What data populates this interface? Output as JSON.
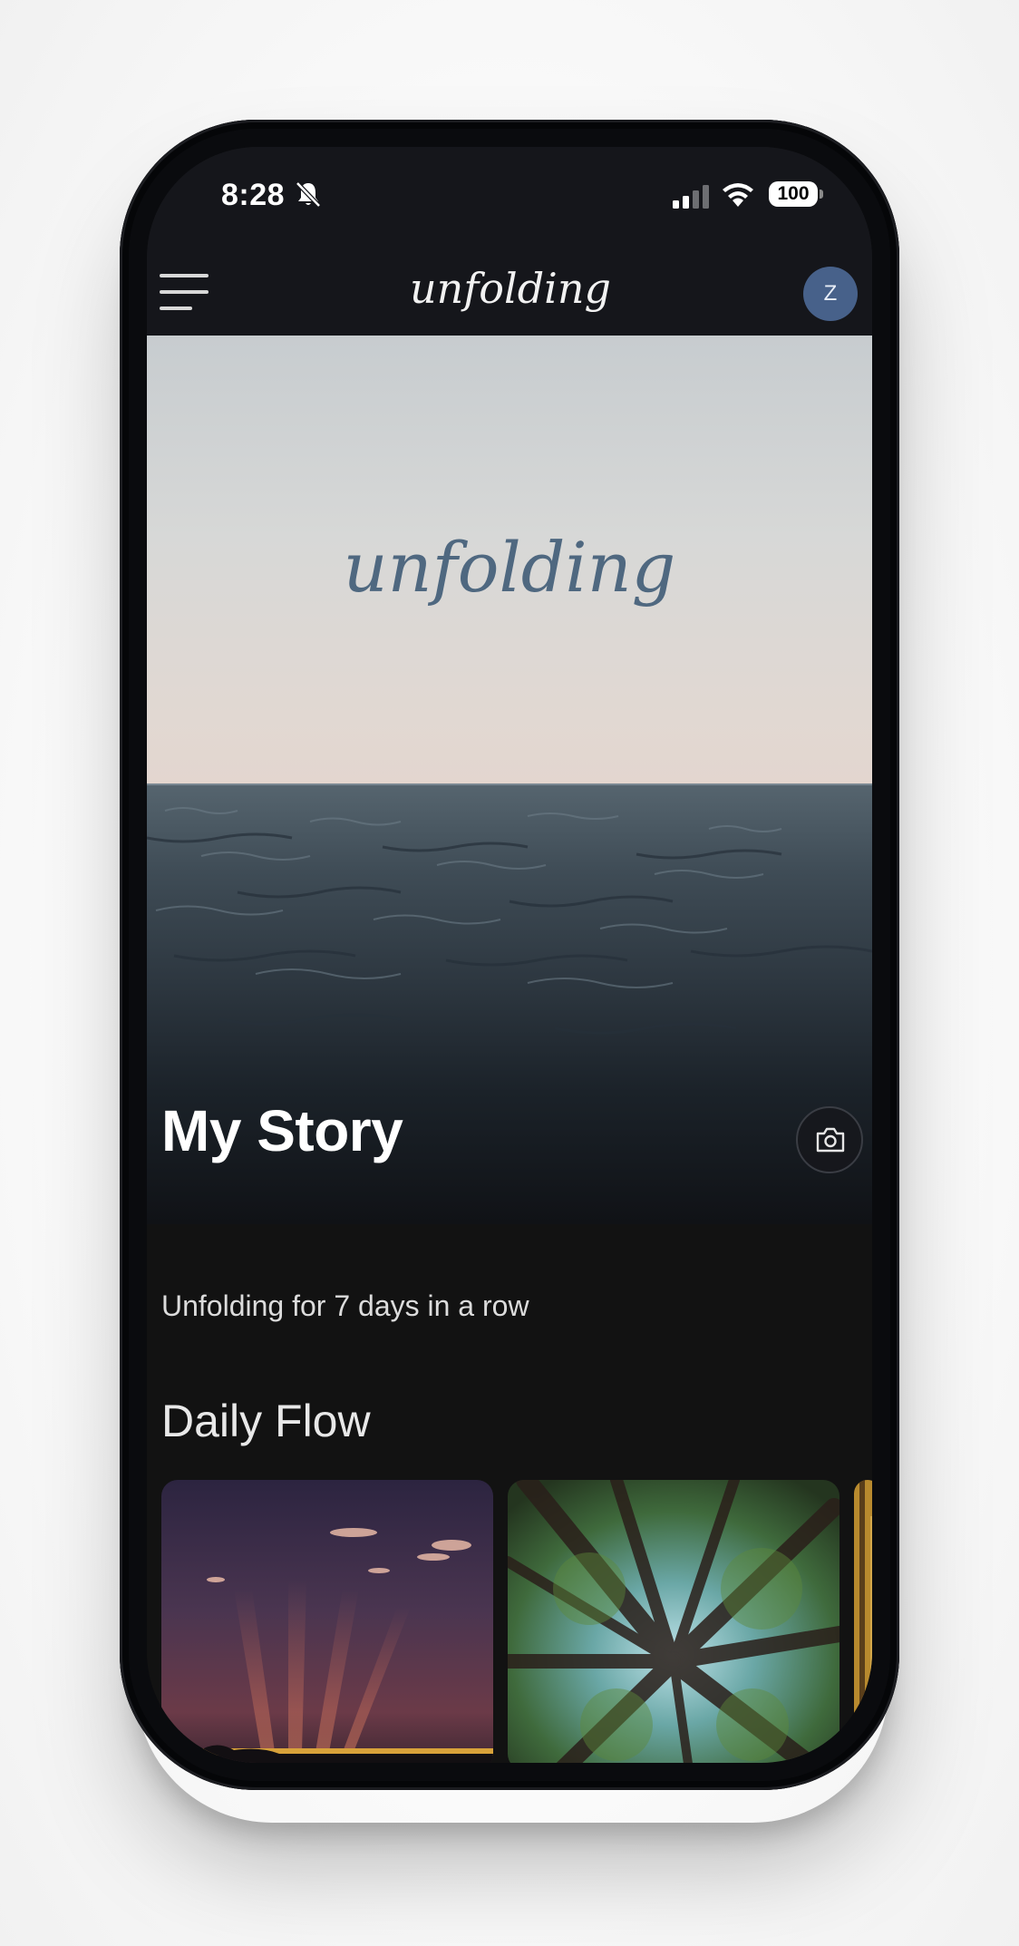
{
  "status_bar": {
    "time": "8:28",
    "battery": "100",
    "icons": [
      "bell-slash-icon",
      "cellular-signal-icon",
      "wifi-icon",
      "battery-icon"
    ]
  },
  "header": {
    "logo_text": "unfolding",
    "avatar_initial": "Z",
    "icons": [
      "hamburger-menu-icon"
    ]
  },
  "hero": {
    "logo_text": "unfolding",
    "title": "My Story",
    "icons": [
      "camera-icon"
    ]
  },
  "streak": {
    "text": "Unfolding for 7 days in a row"
  },
  "daily_flow": {
    "title": "Daily Flow",
    "cards": [
      {
        "scene": "purple-sunset-sky-rays"
      },
      {
        "scene": "forest-canopy-looking-up"
      },
      {
        "scene": "autumn-forest"
      }
    ]
  },
  "colors": {
    "header_bg": "#15161b",
    "avatar_bg": "#47618a",
    "hero_logo": "#4f6880",
    "page_bg": "#121212"
  }
}
